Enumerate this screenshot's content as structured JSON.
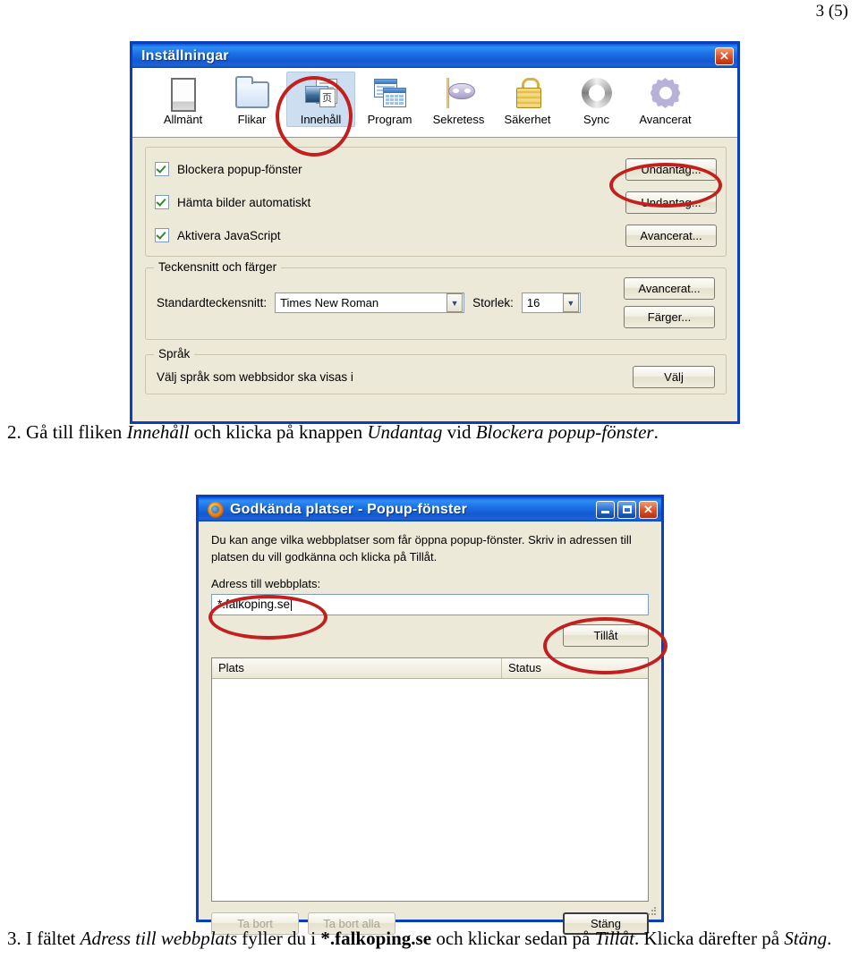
{
  "page": {
    "number": "3 (5)"
  },
  "settings_window": {
    "title": "Inställningar",
    "close_button": "✕",
    "tabs": [
      {
        "label": "Allmänt",
        "icon": "page-icon",
        "selected": false
      },
      {
        "label": "Flikar",
        "icon": "folder-tab-icon",
        "selected": false
      },
      {
        "label": "Innehåll",
        "icon": "content-icon",
        "selected": true
      },
      {
        "label": "Program",
        "icon": "windows-icon",
        "selected": false
      },
      {
        "label": "Sekretess",
        "icon": "mask-icon",
        "selected": false
      },
      {
        "label": "Säkerhet",
        "icon": "padlock-icon",
        "selected": false
      },
      {
        "label": "Sync",
        "icon": "sync-icon",
        "selected": false
      },
      {
        "label": "Avancerat",
        "icon": "gear-icon",
        "selected": false
      }
    ],
    "options": [
      {
        "label": "Blockera popup-fönster",
        "checked": true,
        "button": "Undantag..."
      },
      {
        "label": "Hämta bilder automatiskt",
        "checked": true,
        "button": "Undantag..."
      },
      {
        "label": "Aktivera JavaScript",
        "checked": true,
        "button": "Avancerat..."
      }
    ],
    "fonts_group": {
      "title": "Teckensnitt och färger",
      "font_label": "Standardteckensnitt:",
      "font_value": "Times New Roman",
      "size_label": "Storlek:",
      "size_value": "16",
      "advanced_button": "Avancerat...",
      "colors_button": "Färger..."
    },
    "language_group": {
      "title": "Språk",
      "text": "Välj språk som webbsidor ska visas i",
      "button": "Välj"
    }
  },
  "step2": {
    "number": "2.",
    "p1": " Gå till fliken ",
    "em1": "Innehåll",
    "p2": " och klicka på knappen ",
    "em2": "Undantag",
    "p3": " vid ",
    "em3": "Blockera popup-fönster",
    "p4": "."
  },
  "popup_window": {
    "title": "Godkända platser - Popup-fönster",
    "minimize_button": "_",
    "maximize_button": "□",
    "close_button": "✕",
    "description": "Du kan ange vilka webbplatser som får öppna popup-fönster. Skriv in adressen till platsen du vill godkänna och klicka på Tillåt.",
    "address_label": "Adress till webbplats:",
    "address_value": "*.falkoping.se",
    "allow_button": "Tillåt",
    "columns": [
      "Plats",
      "Status"
    ],
    "rows": [],
    "remove_button": "Ta bort",
    "remove_all_button": "Ta bort alla",
    "close_text_button": "Stäng"
  },
  "step3": {
    "number": "3.",
    "p1": " I fältet ",
    "em1": "Adress till webbplats",
    "p2": " fyller du i ",
    "strong1": "*.falkoping.se",
    "p3": " och klickar sedan på ",
    "em2": "Tillåt",
    "p4": ". Klicka därefter på ",
    "em3": "Stäng",
    "p5": "."
  },
  "annotation_color": "#c21f1f"
}
